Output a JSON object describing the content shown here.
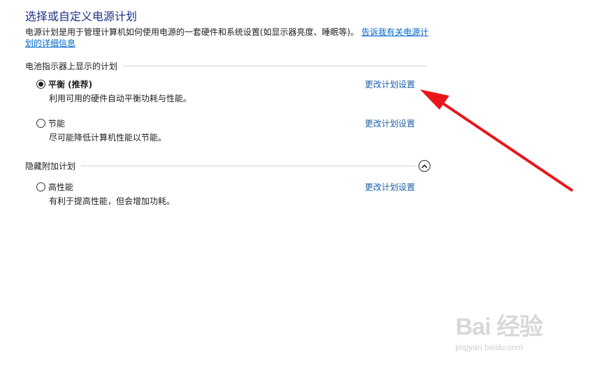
{
  "header": {
    "title": "选择或自定义电源计划",
    "description": "电源计划是用于管理计算机如何使用电源的一套硬件和系统设置(如显示器亮度、睡眠等)。",
    "help_link": "告诉我有关电源计划的详细信息"
  },
  "battery_section": {
    "label": "电池指示器上显示的计划",
    "plans": [
      {
        "name": "平衡 (推荐)",
        "description": "利用可用的硬件自动平衡功耗与性能。",
        "change_link": "更改计划设置",
        "selected": true
      },
      {
        "name": "节能",
        "description": "尽可能降低计算机性能以节能。",
        "change_link": "更改计划设置",
        "selected": false
      }
    ]
  },
  "hidden_section": {
    "label": "隐藏附加计划",
    "collapse_icon": "chevron-up-icon",
    "plans": [
      {
        "name": "高性能",
        "description": "有利于提高性能，但会增加功耗。",
        "change_link": "更改计划设置",
        "selected": false
      }
    ]
  },
  "annotation": {
    "arrow_color": "#e8161b"
  },
  "watermark": {
    "logo_text": "Bai 经验",
    "url": "jingyan.baidu.com"
  },
  "colors": {
    "title": "#1e3287",
    "link": "#1f5fa8",
    "rule": "#d5d5d5"
  }
}
